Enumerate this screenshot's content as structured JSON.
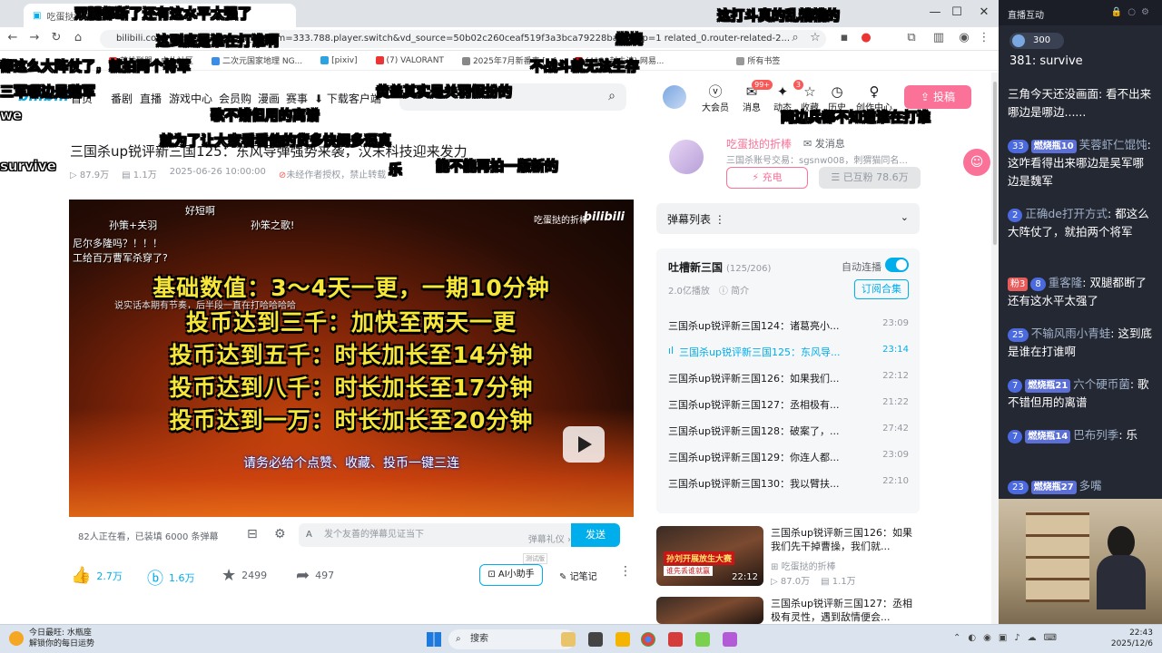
{
  "browser": {
    "tab_title": "吃蛋挞的折棒",
    "url": "bilibili.com/video/BV1...?spm_id_from=333.788.player.switch&vd_source=50b02c260ceaf519f3a3bca79228baa78&p=1 related_0.router-related-2...",
    "bookmarks": [
      "英雄联盟 - 虎扑社区",
      "二次元国家地理 NG...",
      "[pixiv]",
      "(7) VALORANT",
      "2025年7月新番表 [...]",
      "(4129封未读) 网易...",
      "所有书签"
    ]
  },
  "header": {
    "logo": "bilibili",
    "nav": [
      "首页",
      "番剧",
      "直播",
      "游戏中心",
      "会员购",
      "漫画",
      "赛事",
      "下载客户端"
    ],
    "right_items": [
      {
        "label": "大会员",
        "icon": "vip-icon"
      },
      {
        "label": "消息",
        "icon": "mail-icon",
        "badge": "99+"
      },
      {
        "label": "动态",
        "icon": "dynamic-icon",
        "badge": "3"
      },
      {
        "label": "收藏",
        "icon": "star-icon"
      },
      {
        "label": "历史",
        "icon": "history-icon"
      },
      {
        "label": "创作中心",
        "icon": "bulb-icon"
      }
    ],
    "upload": "投稿"
  },
  "video": {
    "title": "三国杀up锐评新三国125：东风导弹强势来袭，汉末科技迎来发力",
    "views": "87.9万",
    "danmaku": "1.1万",
    "datetime": "2025-06-26 10:00:00",
    "copyright": "未经作者授权，禁止转载"
  },
  "player": {
    "up_tag": "吃蛋挞的折棒",
    "brand": "bilibili",
    "lines": [
      "基础数值：3～4天一更，一期10分钟",
      "投币达到三千：加快至两天一更",
      "投币达到五千：时长加长至14分钟",
      "投币达到八千：时长加长至17分钟",
      "投币达到一万：时长加长至20分钟"
    ],
    "subtitle": "请务必给个点赞、收藏、投币一键三连",
    "danmaku": [
      "好短啊",
      "孙策+关羽",
      "孙笨之歌!",
      "尼尔多隆吗？！！！",
      "工给百万曹军杀穿了?",
      "说实话本期有节奏，后半段一直在打哈哈哈哈"
    ]
  },
  "dm_bar": {
    "watching": "82人正在看，已装填 6000 条弹幕",
    "placeholder": "发个友善的弹幕见证当下",
    "etiquette": "弹幕礼仪 ›",
    "send": "发送"
  },
  "actions": {
    "like": "2.7万",
    "coin": "1.6万",
    "fav": "2499",
    "share": "497",
    "ai": "AI小助手",
    "ai_tag": "测试版",
    "notes": "记笔记"
  },
  "up": {
    "name": "吃蛋挞的折棒",
    "message": "发消息",
    "desc": "三国杀账号交易：sgsnw008，刺猬猫同名...",
    "charge": "充电",
    "follow": "已互粉 78.6万"
  },
  "dm_list": {
    "label": "弹幕列表 ⋮"
  },
  "playlist": {
    "title": "吐槽新三国",
    "count": "(125/206)",
    "auto": "自动连播",
    "plays": "2.0亿播放",
    "intro": "简介",
    "subscribe": "订阅合集",
    "items": [
      {
        "t": "三国杀up锐评新三国124：诸葛亮小...",
        "d": "23:09"
      },
      {
        "t": "三国杀up锐评新三国125：东风导...",
        "d": "23:14"
      },
      {
        "t": "三国杀up锐评新三国126：如果我们...",
        "d": "22:12"
      },
      {
        "t": "三国杀up锐评新三国127：丞相极有...",
        "d": "21:22"
      },
      {
        "t": "三国杀up锐评新三国128：破案了，...",
        "d": "27:42"
      },
      {
        "t": "三国杀up锐评新三国129：你连人都...",
        "d": "23:09"
      },
      {
        "t": "三国杀up锐评新三国130：我以臂扶...",
        "d": "22:10"
      }
    ]
  },
  "recs": [
    {
      "title": "三国杀up锐评新三国126：如果我们先干掉曹操，我们就...",
      "up": "吃蛋挞的折棒",
      "views": "87.0万",
      "dm": "1.1万",
      "dur": "22:12",
      "lbl": "孙刘开展放生大赛",
      "lbl2": "谁先丢谁就赢"
    },
    {
      "title": "三国杀up锐评新三国127：丞相极有灵性，遇到敌情便会...",
      "up": "",
      "views": "",
      "dm": "",
      "dur": "",
      "lbl": "",
      "lbl2": ""
    }
  ],
  "overlay_danmaku": [
    {
      "text": "双腿都断了还有这水平太强了",
      "color": "white"
    },
    {
      "text": "这打斗真的乱糟糟的",
      "color": "white"
    },
    {
      "text": "这到底是谁在打谁啊",
      "color": "yellow"
    },
    {
      "text": "燃烧",
      "color": "white"
    },
    {
      "text": "都这么大阵仗了，就拍两个将军",
      "color": "white"
    },
    {
      "text": "不战斗就无法生存",
      "color": "white"
    },
    {
      "text": "三军哪边是魏军",
      "color": "white"
    },
    {
      "text": "黄盖其实是关羽假扮的",
      "color": "white"
    },
    {
      "text": "歌不错但用的离谱",
      "color": "white"
    },
    {
      "text": "两边兵都不知道谁在打谁",
      "color": "yellow"
    },
    {
      "text": "就为了让大家看看他的货多快闹多逼真",
      "color": "white"
    },
    {
      "text": "能不能再拍一版新的",
      "color": "white"
    },
    {
      "text": "乐",
      "color": "white"
    },
    {
      "text": "survive",
      "color": "white"
    },
    {
      "text": "we",
      "color": "white"
    }
  ],
  "chat": {
    "header": "直播互动",
    "top_count": "300",
    "prev": "381: survive",
    "messages": [
      {
        "text": "三角今天还没画面: 看不出来哪边是哪边......"
      },
      {
        "lvl": "33",
        "fan": "燃烧瓶10",
        "name": "芙蓉虾仁馄饨",
        "text": "这咋看得出来哪边是吴军哪边是魏军"
      },
      {
        "lvl": "2",
        "name": "正确de打开方式",
        "text": "都这么大阵仗了，就拍两个将军"
      },
      {
        "adm": "粉3",
        "lvl": "8",
        "name": "重客隆",
        "text": "双腿都断了还有这水平太强了"
      },
      {
        "lvl": "25",
        "name": "不输风雨小青蛙",
        "text": "这到底是谁在打谁啊"
      },
      {
        "lvl": "7",
        "fan": "燃烧瓶21",
        "name": "六个硬币菌",
        "text": "歌不错但用的离谱"
      },
      {
        "lvl": "7",
        "fan": "燃烧瓶14",
        "name": "巴布列季",
        "text": "乐"
      },
      {
        "lvl": "23",
        "fan": "燃烧瓶27",
        "name": "多嘴",
        "text": ""
      }
    ]
  },
  "taskbar": {
    "weather_title": "今日最旺: 水瓶座",
    "weather_sub": "解锁你的每日运势",
    "search": "搜索",
    "time": "22:43",
    "date": "2025/12/6"
  }
}
